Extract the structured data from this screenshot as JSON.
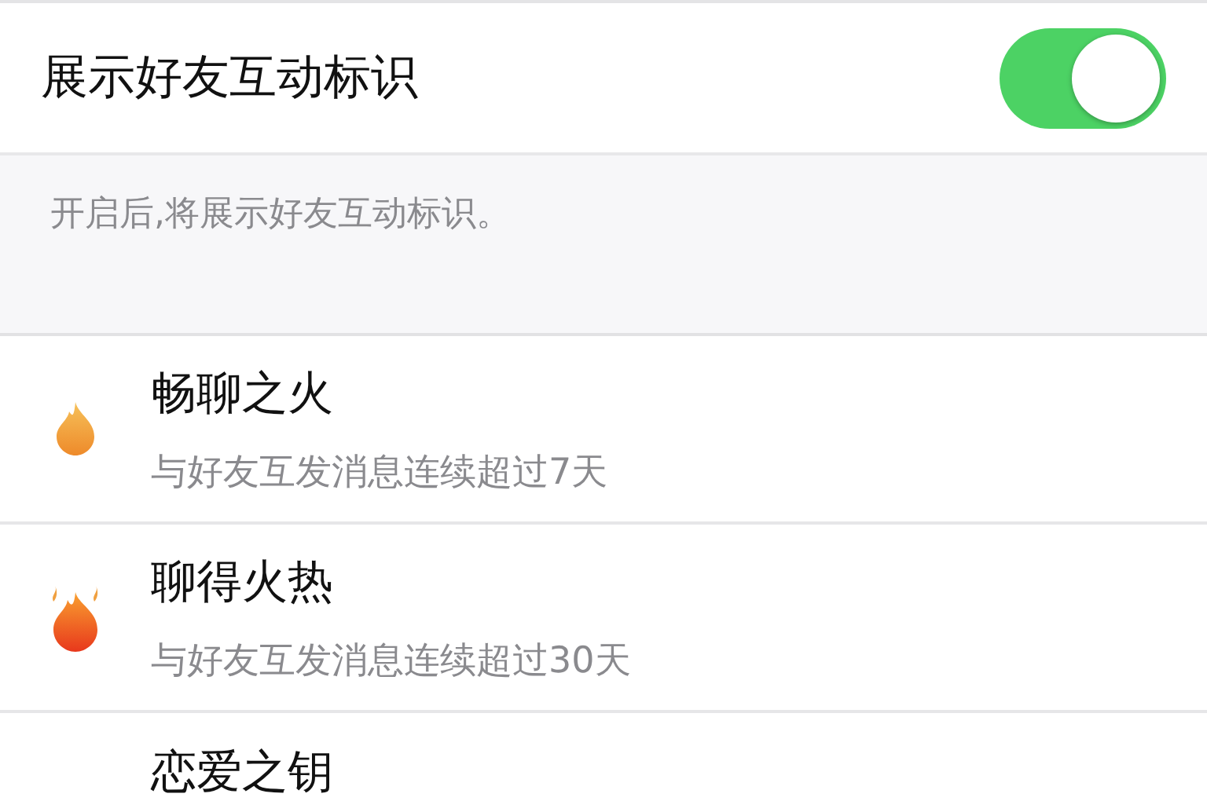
{
  "setting": {
    "label": "展示好友互动标识",
    "on": true
  },
  "hint": "开启后,将展示好友互动标识。",
  "badges": [
    {
      "kind": "flame",
      "title": "畅聊之火",
      "description": "与好友互发消息连续超过7天"
    },
    {
      "kind": "flames",
      "title": "聊得火热",
      "description": "与好友互发消息连续超过30天"
    },
    {
      "title": "恋爱之钥"
    }
  ]
}
